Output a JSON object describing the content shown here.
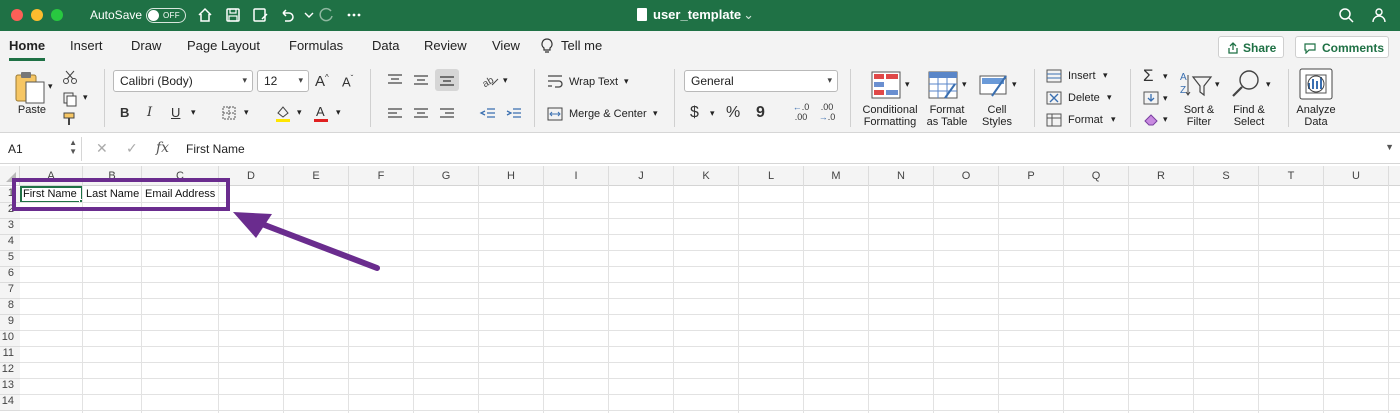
{
  "titlebar": {
    "autosave_label": "AutoSave",
    "autosave_state": "OFF",
    "document_title": "user_template",
    "colors": {
      "background": "#1f7145"
    }
  },
  "tabs": [
    "Home",
    "Insert",
    "Draw",
    "Page Layout",
    "Formulas",
    "Data",
    "Review",
    "View",
    "Tell me"
  ],
  "share_label": "Share",
  "comments_label": "Comments",
  "ribbon": {
    "paste_label": "Paste",
    "font_name": "Calibri (Body)",
    "font_size": "12",
    "bold": "B",
    "italic": "I",
    "underline": "U",
    "wrap_text_label": "Wrap Text",
    "merge_center_label": "Merge & Center",
    "number_format": "General",
    "currency_symbol": "$",
    "percent_symbol": "%",
    "comma_symbol": "9",
    "decimal_increase": ".00",
    "decimal_decrease": ".0",
    "conditional_formatting_label": [
      "Conditional",
      "Formatting"
    ],
    "format_as_table_label": [
      "Format",
      "as Table"
    ],
    "cell_styles_label": [
      "Cell",
      "Styles"
    ],
    "insert_label": "Insert",
    "delete_label": "Delete",
    "format_label": "Format",
    "sort_filter_label": [
      "Sort &",
      "Filter"
    ],
    "find_select_label": [
      "Find &",
      "Select"
    ],
    "analyze_data_label": [
      "Analyze",
      "Data"
    ]
  },
  "formula_bar": {
    "name_box": "A1",
    "fx": "fx",
    "value": "First Name"
  },
  "grid": {
    "columns": [
      "A",
      "B",
      "C",
      "D",
      "E",
      "F",
      "G",
      "H",
      "I",
      "J",
      "K",
      "L",
      "M",
      "N",
      "O",
      "P",
      "Q",
      "R",
      "S",
      "T",
      "U"
    ],
    "rows": [
      "1",
      "2",
      "3",
      "4",
      "5",
      "6",
      "7",
      "8",
      "9",
      "10",
      "11",
      "12",
      "13",
      "14"
    ],
    "cells": {
      "A1": "First Name",
      "B1": "Last Name",
      "C1": "Email Address"
    }
  },
  "annotation": {
    "color": "#6a2c8e"
  }
}
